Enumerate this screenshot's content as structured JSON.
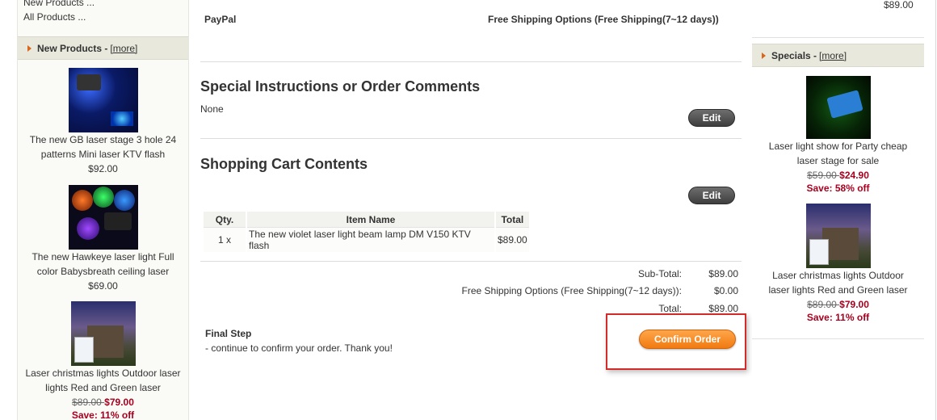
{
  "left": {
    "category_links": [
      "New Products ...",
      "All Products ..."
    ],
    "new_products_box": {
      "title": "New Products - ",
      "more": "[more]",
      "items": [
        {
          "name": "The new GB laser stage 3 hole 24 patterns Mini laser KTV flash",
          "price": "$92.00"
        },
        {
          "name": "The new Hawkeye laser light Full color Babysbreath ceiling laser",
          "price": "$69.00"
        },
        {
          "name": "Laser christmas lights Outdoor laser lights Red and Green laser",
          "old_price": "$89.00 ",
          "new_price": "$79.00",
          "save": "Save: 11% off"
        }
      ]
    }
  },
  "main": {
    "payment_method": "PayPal",
    "shipping_method": "Free Shipping Options (Free Shipping(7~12 days))",
    "comments": {
      "title": "Special Instructions or Order Comments",
      "text": "None",
      "edit": "Edit"
    },
    "cart": {
      "title": "Shopping Cart Contents",
      "edit": "Edit",
      "headers": [
        "Qty.",
        "Item Name",
        "Total"
      ],
      "rows": [
        {
          "qty": "1 x",
          "name": "The new violet laser light beam lamp DM V150 KTV flash",
          "total": "$89.00"
        }
      ]
    },
    "totals": [
      {
        "label": "Sub-Total:",
        "value": "$89.00"
      },
      {
        "label": "Free Shipping Options (Free Shipping(7~12 days)):",
        "value": "$0.00"
      },
      {
        "label": "Total:",
        "value": "$89.00"
      }
    ],
    "final_step": {
      "title": "Final Step",
      "text": "- continue to confirm your order. Thank you!",
      "confirm": "Confirm Order"
    }
  },
  "right": {
    "top_price": "$89.00",
    "specials_box": {
      "title": "Specials - ",
      "more": "[more]",
      "items": [
        {
          "name": "Laser light show for Party cheap laser stage for sale",
          "old_price": "$59.00 ",
          "new_price": "$24.90",
          "save": "Save: 58% off"
        },
        {
          "name": "Laser christmas lights Outdoor laser lights Red and Green laser",
          "old_price": "$89.00 ",
          "new_price": "$79.00",
          "save": "Save: 11% off"
        }
      ]
    }
  },
  "colors": {
    "accent_orange": "#f07a10",
    "price_red": "#a8001e",
    "highlight_red": "#d32a2a"
  }
}
